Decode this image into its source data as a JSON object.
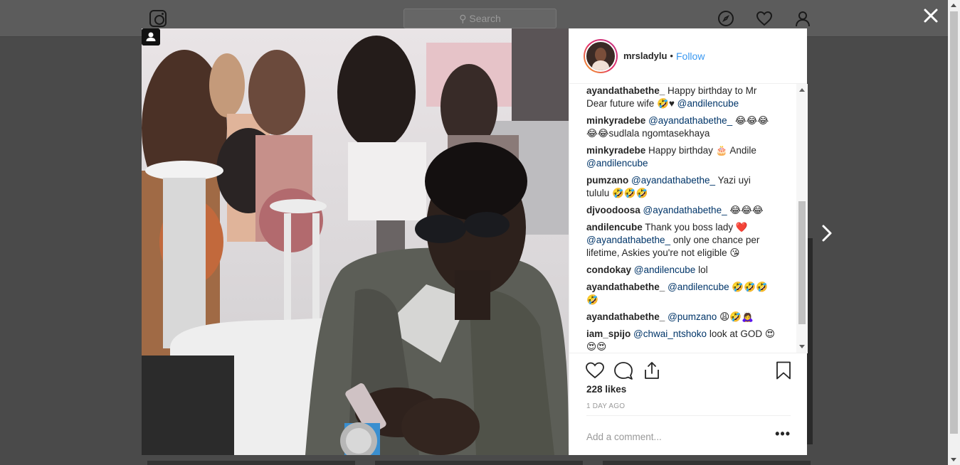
{
  "topbar": {
    "search_placeholder": "Search",
    "icons": [
      "instagram-logo",
      "compass-icon",
      "heart-icon",
      "user-icon"
    ]
  },
  "post": {
    "username": "mrsladylu",
    "dot": "•",
    "follow_label": "Follow",
    "likes": "228 likes",
    "time": "1 DAY AGO",
    "comment_placeholder": "Add a comment...",
    "more_label": "•••",
    "comments": [
      {
        "user": "ayandathabethe_",
        "parts": [
          {
            "t": "text",
            "v": " Happy birthday to Mr Dear future wife 🤣♥ "
          },
          {
            "t": "mention",
            "v": "@andilencube"
          }
        ]
      },
      {
        "user": "minkyradebe",
        "parts": [
          {
            "t": "text",
            "v": " "
          },
          {
            "t": "mention",
            "v": "@ayandathabethe_"
          },
          {
            "t": "text",
            "v": " 😂😂😂😂😂sudlala ngomtasekhaya"
          }
        ]
      },
      {
        "user": "minkyradebe",
        "parts": [
          {
            "t": "text",
            "v": " Happy birthday 🎂 Andile "
          },
          {
            "t": "mention",
            "v": "@andilencube"
          }
        ]
      },
      {
        "user": "pumzano",
        "parts": [
          {
            "t": "text",
            "v": " "
          },
          {
            "t": "mention",
            "v": "@ayandathabethe_"
          },
          {
            "t": "text",
            "v": " Yazi uyi tululu 🤣🤣🤣"
          }
        ]
      },
      {
        "user": "djvoodoosa",
        "parts": [
          {
            "t": "text",
            "v": " "
          },
          {
            "t": "mention",
            "v": "@ayandathabethe_"
          },
          {
            "t": "text",
            "v": " 😂😂😂"
          }
        ]
      },
      {
        "user": "andilencube",
        "parts": [
          {
            "t": "text",
            "v": " Thank you boss lady ❤️ "
          },
          {
            "t": "mention",
            "v": "@ayandathabethe_"
          },
          {
            "t": "text",
            "v": " only one chance per lifetime, Askies you're not eligible 😘"
          }
        ]
      },
      {
        "user": "condokay",
        "parts": [
          {
            "t": "text",
            "v": " "
          },
          {
            "t": "mention",
            "v": "@andilencube"
          },
          {
            "t": "text",
            "v": " lol"
          }
        ]
      },
      {
        "user": "ayandathabethe_",
        "parts": [
          {
            "t": "text",
            "v": " "
          },
          {
            "t": "mention",
            "v": "@andilencube"
          },
          {
            "t": "text",
            "v": " 🤣🤣🤣🤣"
          }
        ]
      },
      {
        "user": "ayandathabethe_",
        "parts": [
          {
            "t": "text",
            "v": " "
          },
          {
            "t": "mention",
            "v": "@pumzano"
          },
          {
            "t": "text",
            "v": " 😩🤣🙇‍♀️"
          }
        ]
      },
      {
        "user": "iam_spijo",
        "parts": [
          {
            "t": "text",
            "v": " "
          },
          {
            "t": "mention",
            "v": "@chwai_ntshoko"
          },
          {
            "t": "text",
            "v": " look at GOD 😍😍😍"
          }
        ]
      }
    ]
  },
  "colors": {
    "link": "#3897f0",
    "mention": "#003569",
    "text": "#262626",
    "muted": "#999999"
  }
}
